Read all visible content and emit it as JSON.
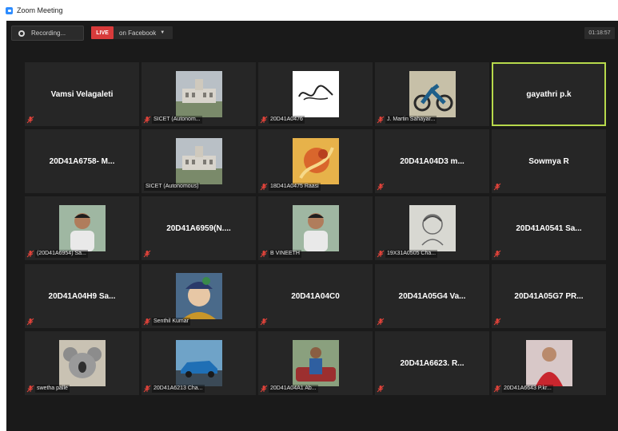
{
  "window": {
    "title": "Zoom Meeting"
  },
  "topbar": {
    "recording_label": "Recording...",
    "live_badge": "LIVE",
    "live_target": "on Facebook",
    "timer": "01:18:57"
  },
  "colors": {
    "live_red": "#d83b3b",
    "active_speaker_outline": "#b7d94b",
    "muted_mic_red": "#e0433a",
    "tile_bg": "#262626",
    "meeting_bg": "#1a1a1a"
  },
  "tiles": [
    {
      "display_name": "Vamsi Velagaleti",
      "caption": "",
      "has_avatar": false,
      "muted": true
    },
    {
      "display_name": "",
      "caption": "SICET (Autonom...",
      "has_avatar": true,
      "avatar": "building-photo",
      "muted": true
    },
    {
      "display_name": "",
      "caption": "20D41A0476",
      "has_avatar": true,
      "avatar": "signature-logo",
      "muted": true
    },
    {
      "display_name": "",
      "caption": "J. Martin Sahayar...",
      "has_avatar": true,
      "avatar": "motorbike-photo",
      "muted": true
    },
    {
      "display_name": "gayathri p.k",
      "caption": "",
      "has_avatar": false,
      "muted": false,
      "active": true
    },
    {
      "display_name": "20D41A6758- M...",
      "caption": "",
      "has_avatar": false,
      "muted": false
    },
    {
      "display_name": "",
      "caption": "SICET (Autonomous)",
      "has_avatar": true,
      "avatar": "building-photo",
      "muted": false
    },
    {
      "display_name": "",
      "caption": "18D41A0475 Raasi",
      "has_avatar": true,
      "avatar": "abstract-art",
      "muted": true
    },
    {
      "display_name": "20D41A04D3 m...",
      "caption": "",
      "has_avatar": false,
      "muted": true
    },
    {
      "display_name": "Sowmya R",
      "caption": "",
      "has_avatar": false,
      "muted": true
    },
    {
      "display_name": "",
      "caption": "(20D41A6954) Sa...",
      "has_avatar": true,
      "avatar": "person-photo",
      "muted": true
    },
    {
      "display_name": "20D41A6959(N....",
      "caption": "",
      "has_avatar": false,
      "muted": true
    },
    {
      "display_name": "",
      "caption": "B VINEETH",
      "has_avatar": true,
      "avatar": "person-photo",
      "muted": true
    },
    {
      "display_name": "",
      "caption": "19X31A0505 Cha...",
      "has_avatar": true,
      "avatar": "sketch-photo",
      "muted": true
    },
    {
      "display_name": "20D41A0541 Sa...",
      "caption": "",
      "has_avatar": false,
      "muted": true
    },
    {
      "display_name": "20D41A04H9 Sa...",
      "caption": "",
      "has_avatar": false,
      "muted": true
    },
    {
      "display_name": "",
      "caption": "Senthil Kumar",
      "has_avatar": true,
      "avatar": "krishna-art",
      "muted": true
    },
    {
      "display_name": "20D41A04C0",
      "caption": "",
      "has_avatar": false,
      "muted": true
    },
    {
      "display_name": "20D41A05G4 Va...",
      "caption": "",
      "has_avatar": false,
      "muted": true
    },
    {
      "display_name": "20D41A05G7 PR...",
      "caption": "",
      "has_avatar": false,
      "muted": true
    },
    {
      "display_name": "",
      "caption": "swetha palle",
      "has_avatar": true,
      "avatar": "koala-photo",
      "muted": true
    },
    {
      "display_name": "",
      "caption": "20D41A6213 Cha...",
      "has_avatar": true,
      "avatar": "car-photo",
      "muted": true
    },
    {
      "display_name": "",
      "caption": "20D41A04A1 Ab...",
      "has_avatar": true,
      "avatar": "person-car-photo",
      "muted": true
    },
    {
      "display_name": "20D41A6623. R...",
      "caption": "",
      "has_avatar": false,
      "muted": true
    },
    {
      "display_name": "",
      "caption": "20D41A6643 P.kr...",
      "has_avatar": true,
      "avatar": "person-red-photo",
      "muted": true
    }
  ]
}
